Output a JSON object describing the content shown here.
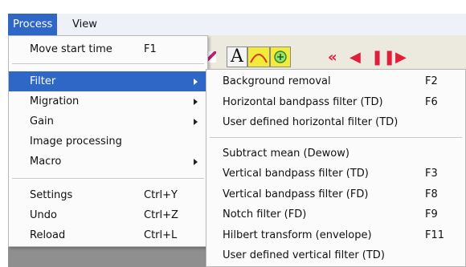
{
  "menubar": {
    "items": [
      {
        "label": "Process"
      },
      {
        "label": "View"
      }
    ]
  },
  "toolbar": {
    "text_tool_letter": "A",
    "red_arrows": [
      "«",
      "◀",
      "❚❚",
      "▶"
    ]
  },
  "process_menu": {
    "items": [
      {
        "label": "Move start time",
        "shortcut": "F1"
      },
      {
        "label": "Filter"
      },
      {
        "label": "Migration"
      },
      {
        "label": "Gain"
      },
      {
        "label": "Image processing"
      },
      {
        "label": "Macro"
      },
      {
        "label": "Settings",
        "shortcut": "Ctrl+Y"
      },
      {
        "label": "Undo",
        "shortcut": "Ctrl+Z"
      },
      {
        "label": "Reload",
        "shortcut": "Ctrl+L"
      }
    ]
  },
  "filter_submenu": {
    "items": [
      {
        "label": "Background removal",
        "shortcut": "F2"
      },
      {
        "label": "Horizontal bandpass filter (TD)",
        "shortcut": "F6"
      },
      {
        "label": "User defined horizontal filter (TD)",
        "shortcut": ""
      },
      {
        "label": "Subtract mean (Dewow)",
        "shortcut": ""
      },
      {
        "label": "Vertical bandpass filter (TD)",
        "shortcut": "F3"
      },
      {
        "label": "Vertical bandpass filter (FD)",
        "shortcut": "F8"
      },
      {
        "label": "Notch filter (FD)",
        "shortcut": "F9"
      },
      {
        "label": "Hilbert transform (envelope)",
        "shortcut": "F11"
      },
      {
        "label": "User defined vertical filter (TD)",
        "shortcut": ""
      }
    ]
  },
  "colors": {
    "highlight": "#2f67c6",
    "menubar": "#eef2f8",
    "menu_bg": "#fbfbfb"
  }
}
